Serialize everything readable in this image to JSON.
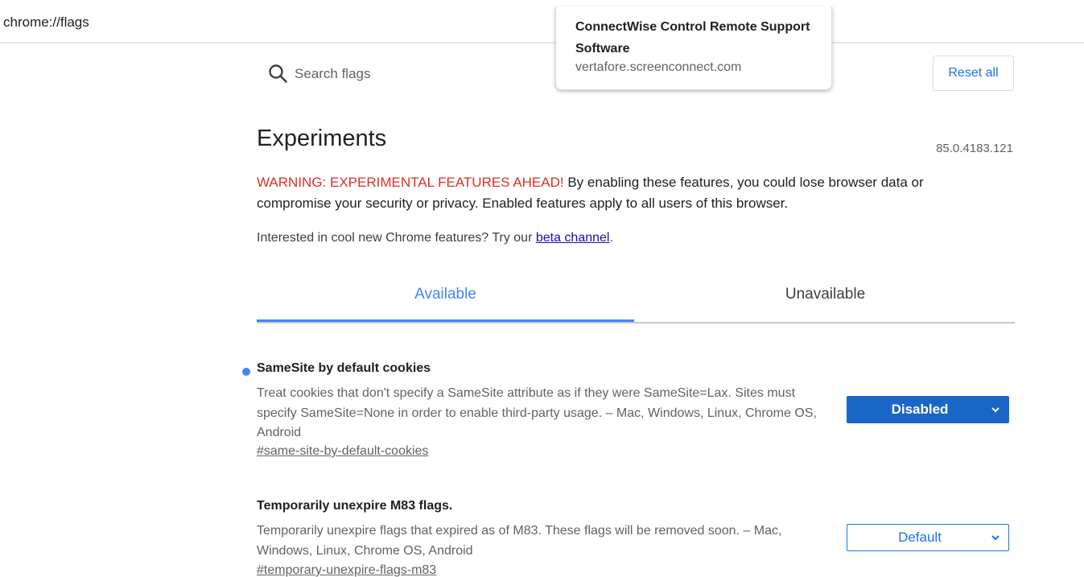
{
  "address_bar": {
    "url": "chrome://flags"
  },
  "tooltip": {
    "title": "ConnectWise Control Remote Support Software",
    "url": "vertafore.screenconnect.com"
  },
  "search": {
    "placeholder": "Search flags"
  },
  "header": {
    "reset_label": "Reset all",
    "title": "Experiments",
    "version": "85.0.4183.121"
  },
  "warning": {
    "strong": "WARNING: EXPERIMENTAL FEATURES AHEAD!",
    "text": " By enabling these features, you could lose browser data or compromise your security or privacy. Enabled features apply to all users of this browser."
  },
  "interest": {
    "text": "Interested in cool new Chrome features? Try our ",
    "link_label": "beta channel",
    "suffix": "."
  },
  "tabs": [
    {
      "label": "Available",
      "active": true
    },
    {
      "label": "Unavailable",
      "active": false
    }
  ],
  "experiments": [
    {
      "name": "SameSite by default cookies",
      "modified": true,
      "description": "Treat cookies that don't specify a SameSite attribute as if they were SameSite=Lax. Sites must specify SameSite=None in order to enable third-party usage. – Mac, Windows, Linux, Chrome OS, Android",
      "link": "#same-site-by-default-cookies",
      "selected": "Disabled"
    },
    {
      "name": "Temporarily unexpire M83 flags.",
      "modified": false,
      "description": "Temporarily unexpire flags that expired as of M83. These flags will be removed soon. – Mac, Windows, Linux, Chrome OS, Android",
      "link": "#temporary-unexpire-flags-m83",
      "selected": "Default"
    }
  ],
  "colors": {
    "accent": "#1a73e8",
    "tab_active": "#4285f4",
    "warning": "#d93025",
    "select_enabled_bg": "#1a66c8"
  },
  "icons": {
    "search": "search-icon",
    "chevron": "chevron-down-icon",
    "modified_dot": "modified-indicator-dot"
  }
}
